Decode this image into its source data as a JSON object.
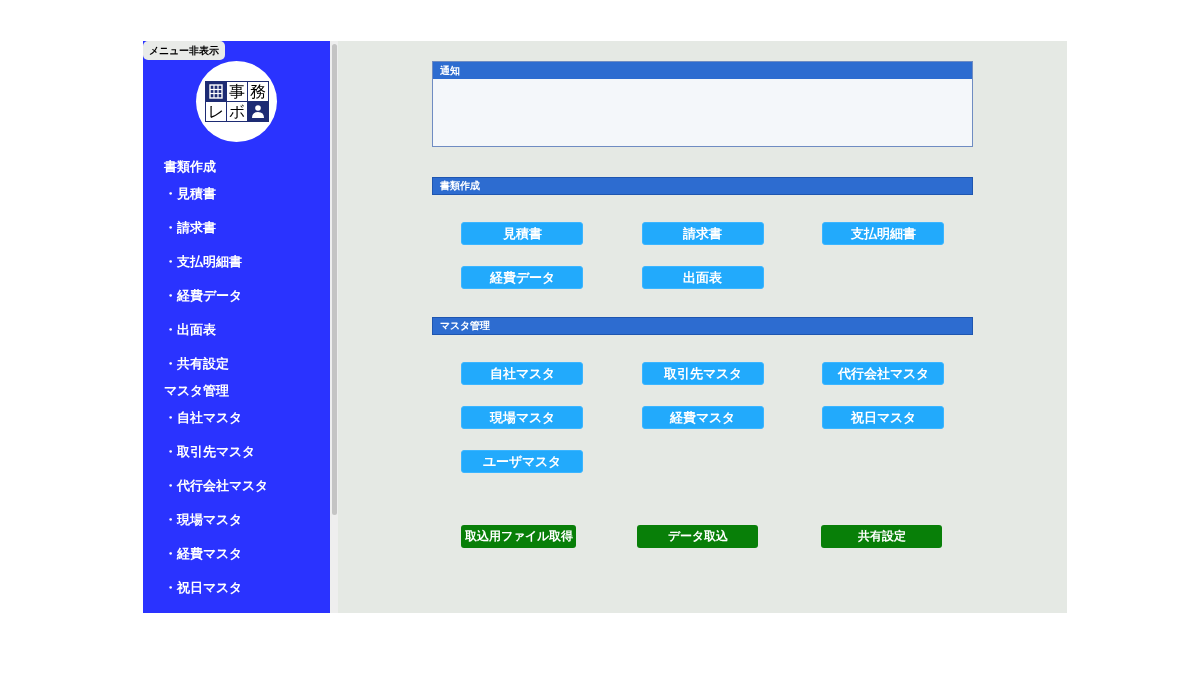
{
  "menu_toggle": {
    "label": "メニュー非表示"
  },
  "logo": {
    "tiles": [
      {
        "kind": "building"
      },
      {
        "kind": "char",
        "text": "事"
      },
      {
        "kind": "char",
        "text": "務"
      },
      {
        "kind": "char",
        "text": "レ"
      },
      {
        "kind": "char",
        "text": "ボ"
      },
      {
        "kind": "person"
      }
    ]
  },
  "sidebar": {
    "sections": [
      {
        "heading": "書類作成",
        "items": [
          "・見積書",
          "・請求書",
          "・支払明細書",
          "・経費データ",
          "・出面表",
          "・共有設定"
        ]
      },
      {
        "heading": "マスタ管理",
        "items": [
          "・自社マスタ",
          "・取引先マスタ",
          "・代行会社マスタ",
          "・現場マスタ",
          "・経費マスタ",
          "・祝日マスタ"
        ]
      }
    ]
  },
  "notice": {
    "title": "通知"
  },
  "sections": [
    {
      "title": "書類作成",
      "buttons": [
        "見積書",
        "請求書",
        "支払明細書",
        "経費データ",
        "出面表"
      ]
    },
    {
      "title": "マスタ管理",
      "buttons": [
        "自社マスタ",
        "取引先マスタ",
        "代行会社マスタ",
        "現場マスタ",
        "経費マスタ",
        "祝日マスタ",
        "ユーザマスタ"
      ]
    }
  ],
  "actions": [
    "取込用ファイル取得",
    "データ取込",
    "共有設定"
  ]
}
